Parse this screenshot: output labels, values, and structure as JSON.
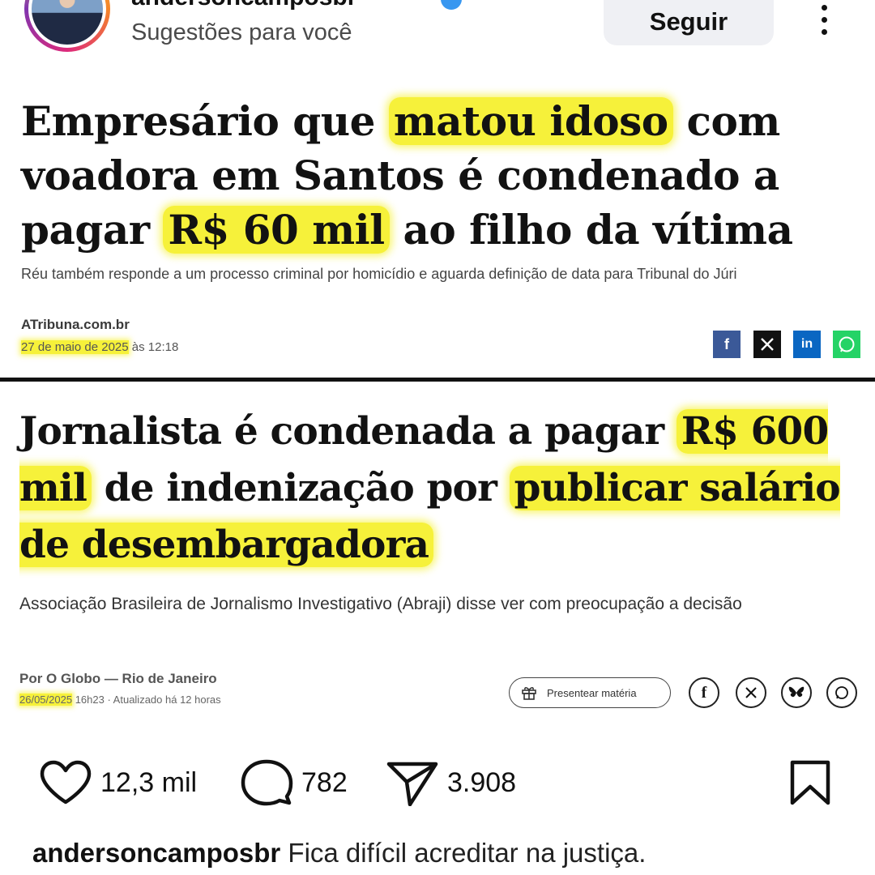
{
  "post_header": {
    "username": "andersoncamposbr",
    "subtitle": "Sugestões para você",
    "follow_label": "Seguir"
  },
  "article1": {
    "headline_parts": [
      "Empresário que ",
      "matou idoso",
      " com voadora em Santos é condenado a pagar ",
      "R$ 60 mil",
      " ao filho da vítima"
    ],
    "subtitle": "Réu também responde a um processo criminal por homicídio e aguarda definição de data para Tribunal do Júri",
    "source": "ATribuna.com.br",
    "date": "27 de maio de 2025",
    "time": " às 12:18",
    "share_icons": [
      "facebook-icon",
      "x-icon",
      "linkedin-icon",
      "whatsapp-icon"
    ]
  },
  "article2": {
    "headline_parts": [
      "Jornalista é condenada a pagar ",
      "R$ 600 mil",
      " de indenização por ",
      "publicar salário de desembargadora"
    ],
    "subtitle": "Associação Brasileira de Jornalismo Investigativo (Abraji) disse ver com preocupação a decisão",
    "byline": "Por O Globo — Rio de Janeiro",
    "date": "26/05/2025",
    "time_updated": " 16h23 · Atualizado há 12 horas",
    "gift_label": "Presentear matéria",
    "share_icons": [
      "facebook-icon",
      "x-icon",
      "bluesky-icon",
      "whatsapp-icon"
    ]
  },
  "actions": {
    "likes": "12,3 mil",
    "comments": "782",
    "shares": "3.908"
  },
  "caption": {
    "username": "andersoncamposbr",
    "text": " Fica difícil acreditar na justiça."
  },
  "colors": {
    "highlight": "#f6f13a",
    "follow_bg": "#eff0f4",
    "facebook": "#3b5998",
    "linkedin": "#0a66c2",
    "whatsapp": "#25d366"
  }
}
